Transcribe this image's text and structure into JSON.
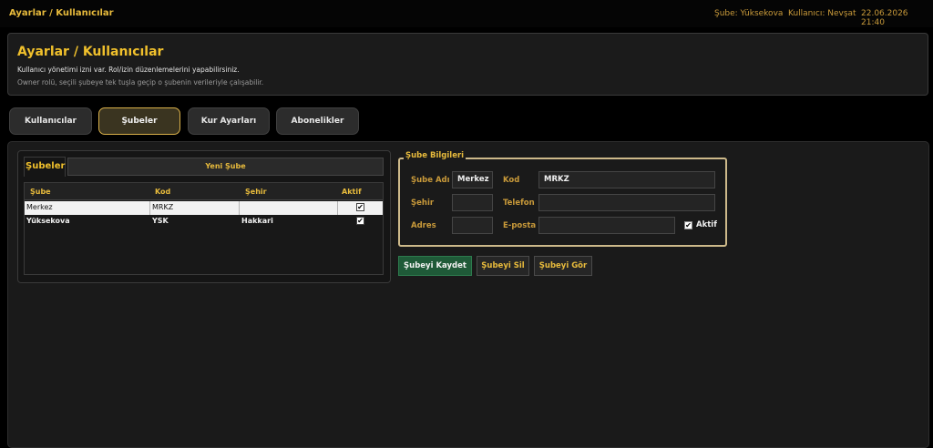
{
  "topbar": {
    "title": "Ayarlar / Kullanıcılar",
    "branch": "Şube: Yüksekova",
    "user": "Kullanıcı: Nevşat",
    "datetime": "22.06.2026 21:40"
  },
  "header": {
    "title": "Ayarlar / Kullanıcılar",
    "line1": "Kullanıcı yönetimi izni var. Rol/izin düzenlemelerini yapabilirsiniz.",
    "line2": "Owner rolü, seçili şubeye tek tuşla geçip o şubenin verileriyle çalışabilir."
  },
  "tabs": [
    {
      "label": "Kullanıcılar",
      "active": false
    },
    {
      "label": "Şubeler",
      "active": true
    },
    {
      "label": "Kur Ayarları",
      "active": false
    },
    {
      "label": "Abonelikler",
      "active": false
    }
  ],
  "branches": {
    "subtab_list": "Şubeler",
    "subtab_new": "Yeni Şube",
    "columns": [
      "Şube",
      "Kod",
      "Şehir",
      "Aktif"
    ],
    "rows": [
      {
        "name": "Merkez",
        "code": "MRKZ",
        "city": "",
        "active": true
      },
      {
        "name": "Yüksekova",
        "code": "YSK",
        "city": "Hakkari",
        "active": true
      }
    ]
  },
  "form": {
    "legend": "Şube Bilgileri",
    "name_label": "Şube Adı",
    "name_value": "Merkez",
    "code_label": "Kod",
    "code_value": "MRKZ",
    "city_label": "Şehir",
    "city_value": "",
    "phone_label": "Telefon",
    "phone_value": "",
    "address_label": "Adres",
    "address_value": "",
    "email_label": "E-posta",
    "email_value": "",
    "active_label": "Aktif",
    "active_checked": true
  },
  "actions": {
    "save": "Şubeyi Kaydet",
    "delete": "Şubeyi Sil",
    "view": "Şubeyi Gör"
  },
  "icons": {
    "checkbox_checked": "✔"
  },
  "colors": {
    "accent": "#f0c02c",
    "save_button": "#1f5a38"
  }
}
